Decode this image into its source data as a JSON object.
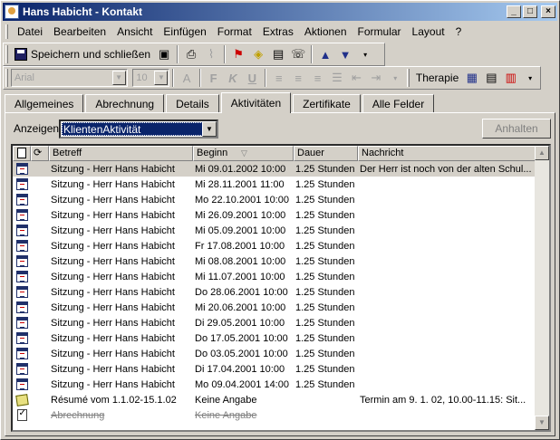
{
  "window": {
    "title": "Hans Habicht - Kontakt"
  },
  "menu": [
    "Datei",
    "Bearbeiten",
    "Ansicht",
    "Einfügen",
    "Format",
    "Extras",
    "Aktionen",
    "Formular",
    "Layout",
    "?"
  ],
  "toolbar": {
    "save_label": "Speichern und schließen",
    "font_name": "Arial",
    "font_size": "10",
    "therapie_label": "Therapie"
  },
  "tabs": [
    "Allgemeines",
    "Abrechnung",
    "Details",
    "Aktivitäten",
    "Zertifikate",
    "Alle Felder"
  ],
  "active_tab": "Aktivitäten",
  "filter": {
    "label": "Anzeigen:",
    "value": "KlientenAktivität",
    "halt_button": "Anhalten"
  },
  "table": {
    "columns": [
      "Betreff",
      "Beginn",
      "Dauer",
      "Nachricht"
    ],
    "rows": [
      {
        "icon": "calendar-icon",
        "subject": "Sitzung - Herr Hans Habicht",
        "start": "Mi 09.01.2002 10:00",
        "duration": "1.25 Stunden",
        "message": "Der Herr ist noch von der alten Schul..."
      },
      {
        "icon": "calendar-icon",
        "subject": "Sitzung - Herr Hans Habicht",
        "start": "Mi 28.11.2001 11:00",
        "duration": "1.25 Stunden",
        "message": ""
      },
      {
        "icon": "calendar-icon",
        "subject": "Sitzung - Herr Hans Habicht",
        "start": "Mo 22.10.2001 10:00",
        "duration": "1.25 Stunden",
        "message": ""
      },
      {
        "icon": "calendar-icon",
        "subject": "Sitzung - Herr Hans Habicht",
        "start": "Mi 26.09.2001 10:00",
        "duration": "1.25 Stunden",
        "message": ""
      },
      {
        "icon": "calendar-icon",
        "subject": "Sitzung - Herr Hans Habicht",
        "start": "Mi 05.09.2001 10:00",
        "duration": "1.25 Stunden",
        "message": ""
      },
      {
        "icon": "calendar-icon",
        "subject": "Sitzung - Herr Hans Habicht",
        "start": "Fr 17.08.2001 10:00",
        "duration": "1.25 Stunden",
        "message": ""
      },
      {
        "icon": "calendar-icon",
        "subject": "Sitzung - Herr Hans Habicht",
        "start": "Mi 08.08.2001 10:00",
        "duration": "1.25 Stunden",
        "message": ""
      },
      {
        "icon": "calendar-icon",
        "subject": "Sitzung - Herr Hans Habicht",
        "start": "Mi 11.07.2001 10:00",
        "duration": "1.25 Stunden",
        "message": ""
      },
      {
        "icon": "calendar-icon",
        "subject": "Sitzung - Herr Hans Habicht",
        "start": "Do 28.06.2001 10:00",
        "duration": "1.25 Stunden",
        "message": ""
      },
      {
        "icon": "calendar-icon",
        "subject": "Sitzung - Herr Hans Habicht",
        "start": "Mi 20.06.2001 10:00",
        "duration": "1.25 Stunden",
        "message": ""
      },
      {
        "icon": "calendar-icon",
        "subject": "Sitzung - Herr Hans Habicht",
        "start": "Di 29.05.2001 10:00",
        "duration": "1.25 Stunden",
        "message": ""
      },
      {
        "icon": "calendar-icon",
        "subject": "Sitzung - Herr Hans Habicht",
        "start": "Do 17.05.2001 10:00",
        "duration": "1.25 Stunden",
        "message": ""
      },
      {
        "icon": "calendar-icon",
        "subject": "Sitzung - Herr Hans Habicht",
        "start": "Do 03.05.2001 10:00",
        "duration": "1.25 Stunden",
        "message": ""
      },
      {
        "icon": "calendar-icon",
        "subject": "Sitzung - Herr Hans Habicht",
        "start": "Di 17.04.2001 10:00",
        "duration": "1.25 Stunden",
        "message": ""
      },
      {
        "icon": "calendar-icon",
        "subject": "Sitzung - Herr Hans Habicht",
        "start": "Mo 09.04.2001 14:00",
        "duration": "1.25 Stunden",
        "message": ""
      },
      {
        "icon": "note-icon",
        "subject": "Résumé vom 1.1.02-15.1.02",
        "start": "Keine Angabe",
        "duration": "",
        "message": "Termin am 9. 1. 02, 10.00-11.15: Sit..."
      },
      {
        "icon": "task-icon",
        "subject": "Abrechnung",
        "start": "Keine Angabe",
        "duration": "",
        "message": "",
        "done": true
      }
    ]
  }
}
